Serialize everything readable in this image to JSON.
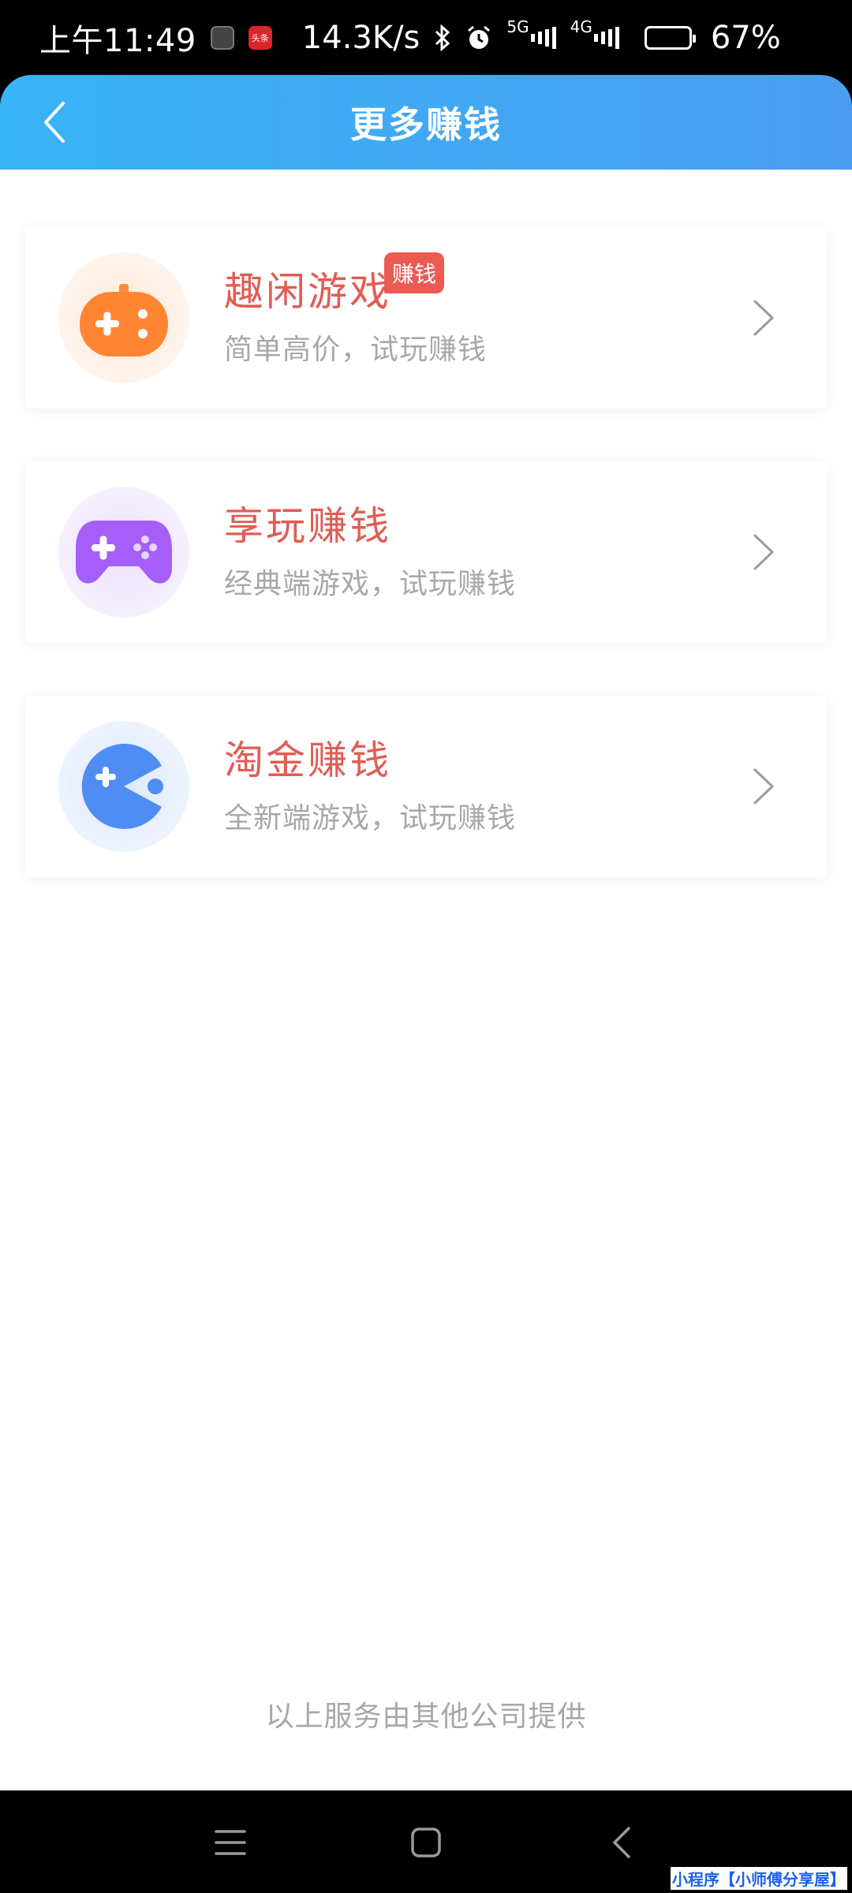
{
  "status_bar": {
    "time": "上午11:49",
    "news_app_label": "头条",
    "net_speed": "14.3K/s",
    "network_1": "5G",
    "network_2": "4G",
    "battery": "67%"
  },
  "header": {
    "title": "更多赚钱",
    "back_icon": "chevron-left-icon"
  },
  "cards": [
    {
      "title": "趣闲游戏",
      "subtitle": "简单高价，试玩赚钱",
      "badge": "赚钱",
      "icon": "game-controller-icon",
      "color": "#ff8c3a",
      "bg": "#fff1e7"
    },
    {
      "title": "享玩赚钱",
      "subtitle": "经典端游戏，试玩赚钱",
      "icon": "gamepad-icon",
      "color": "#a55ef7",
      "bg": "#f3eafe"
    },
    {
      "title": "淘金赚钱",
      "subtitle": "全新端游戏，试玩赚钱",
      "icon": "pacman-icon",
      "color": "#4f8df4",
      "bg": "#e9f1fe"
    }
  ],
  "footer_note": "以上服务由其他公司提供",
  "nav": {
    "menu_icon": "menu-icon",
    "home_icon": "home-icon",
    "back_icon": "back-icon"
  },
  "watermark": "小程序【小师傅分享屋】"
}
